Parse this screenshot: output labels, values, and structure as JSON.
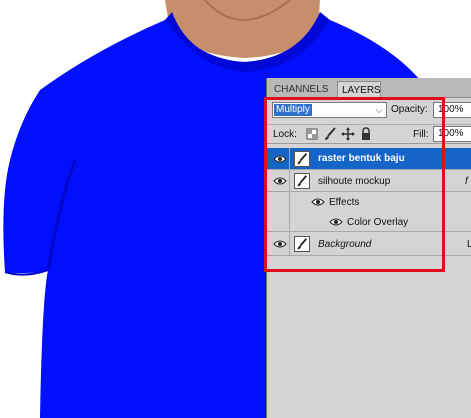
{
  "tabs": {
    "channels": "CHANNELS",
    "layers": "LAYERS"
  },
  "blend": {
    "value": "Multiply",
    "arrow": "⌵"
  },
  "opacity": {
    "label": "Opacity:",
    "value": "100%"
  },
  "lock": {
    "label": "Lock:"
  },
  "fill": {
    "label": "Fill:",
    "value": "100%"
  },
  "layers": {
    "layer1": "raster bentuk baju",
    "layer2": "silhoute mockup",
    "layer2_fx": "f",
    "effects": "Effects",
    "color_overlay": "Color Overlay",
    "background": "Background",
    "background_lock": "L"
  },
  "colors": {
    "shirt": "#0010ff",
    "selection": "#1565c8",
    "highlight": "#e0101a",
    "panel": "#d4d4d4"
  }
}
